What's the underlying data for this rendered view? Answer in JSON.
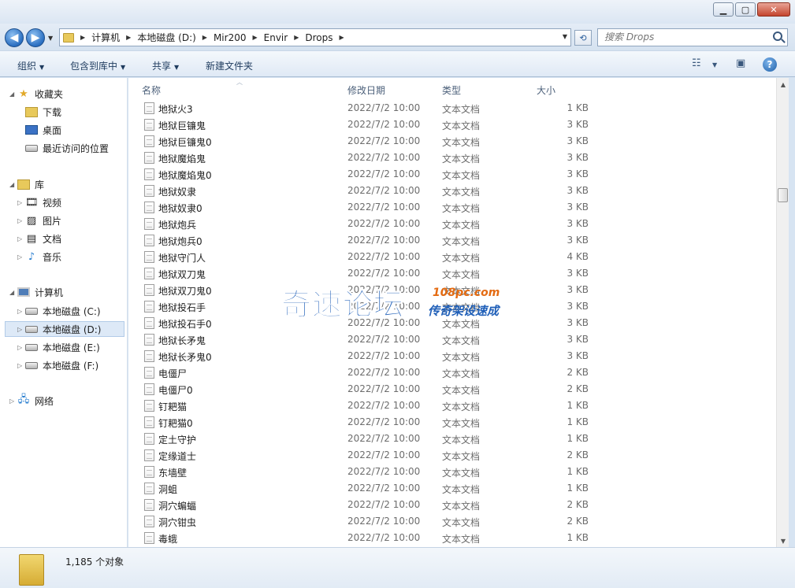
{
  "window": {
    "minimize_glyph": "▁",
    "maximize_glyph": "▢",
    "close_glyph": "✕"
  },
  "address": {
    "crumbs": [
      "计算机",
      "本地磁盘 (D:)",
      "Mir200",
      "Envir",
      "Drops"
    ],
    "search_placeholder": "搜索 Drops"
  },
  "toolbar": {
    "organize": "组织",
    "include_in_library": "包含到库中",
    "share": "共享",
    "new_folder": "新建文件夹"
  },
  "nav": {
    "favorites": "收藏夹",
    "downloads": "下载",
    "desktop": "桌面",
    "recent": "最近访问的位置",
    "libraries": "库",
    "videos": "视频",
    "pictures": "图片",
    "documents": "文档",
    "music": "音乐",
    "computer": "计算机",
    "drive_c": "本地磁盘 (C:)",
    "drive_d": "本地磁盘 (D:)",
    "drive_e": "本地磁盘 (E:)",
    "drive_f": "本地磁盘 (F:)",
    "network": "网络"
  },
  "columns": {
    "name": "名称",
    "date": "修改日期",
    "type": "类型",
    "size": "大小"
  },
  "files": [
    {
      "name": "地狱火3",
      "date": "2022/7/2 10:00",
      "type": "文本文档",
      "size": "1 KB"
    },
    {
      "name": "地狱巨镰鬼",
      "date": "2022/7/2 10:00",
      "type": "文本文档",
      "size": "3 KB"
    },
    {
      "name": "地狱巨镰鬼0",
      "date": "2022/7/2 10:00",
      "type": "文本文档",
      "size": "3 KB"
    },
    {
      "name": "地狱魔焰鬼",
      "date": "2022/7/2 10:00",
      "type": "文本文档",
      "size": "3 KB"
    },
    {
      "name": "地狱魔焰鬼0",
      "date": "2022/7/2 10:00",
      "type": "文本文档",
      "size": "3 KB"
    },
    {
      "name": "地狱奴隶",
      "date": "2022/7/2 10:00",
      "type": "文本文档",
      "size": "3 KB"
    },
    {
      "name": "地狱奴隶0",
      "date": "2022/7/2 10:00",
      "type": "文本文档",
      "size": "3 KB"
    },
    {
      "name": "地狱炮兵",
      "date": "2022/7/2 10:00",
      "type": "文本文档",
      "size": "3 KB"
    },
    {
      "name": "地狱炮兵0",
      "date": "2022/7/2 10:00",
      "type": "文本文档",
      "size": "3 KB"
    },
    {
      "name": "地狱守门人",
      "date": "2022/7/2 10:00",
      "type": "文本文档",
      "size": "4 KB"
    },
    {
      "name": "地狱双刀鬼",
      "date": "2022/7/2 10:00",
      "type": "文本文档",
      "size": "3 KB"
    },
    {
      "name": "地狱双刀鬼0",
      "date": "2022/7/2 10:00",
      "type": "文本文档",
      "size": "3 KB"
    },
    {
      "name": "地狱投石手",
      "date": "2022/7/2 10:00",
      "type": "文本文档",
      "size": "3 KB"
    },
    {
      "name": "地狱投石手0",
      "date": "2022/7/2 10:00",
      "type": "文本文档",
      "size": "3 KB"
    },
    {
      "name": "地狱长矛鬼",
      "date": "2022/7/2 10:00",
      "type": "文本文档",
      "size": "3 KB"
    },
    {
      "name": "地狱长矛鬼0",
      "date": "2022/7/2 10:00",
      "type": "文本文档",
      "size": "3 KB"
    },
    {
      "name": "电僵尸",
      "date": "2022/7/2 10:00",
      "type": "文本文档",
      "size": "2 KB"
    },
    {
      "name": "电僵尸0",
      "date": "2022/7/2 10:00",
      "type": "文本文档",
      "size": "2 KB"
    },
    {
      "name": "钉耙猫",
      "date": "2022/7/2 10:00",
      "type": "文本文档",
      "size": "1 KB"
    },
    {
      "name": "钉耙猫0",
      "date": "2022/7/2 10:00",
      "type": "文本文档",
      "size": "1 KB"
    },
    {
      "name": "定土守护",
      "date": "2022/7/2 10:00",
      "type": "文本文档",
      "size": "1 KB"
    },
    {
      "name": "定缘道士",
      "date": "2022/7/2 10:00",
      "type": "文本文档",
      "size": "2 KB"
    },
    {
      "name": "东墙壁",
      "date": "2022/7/2 10:00",
      "type": "文本文档",
      "size": "1 KB"
    },
    {
      "name": "洞蛆",
      "date": "2022/7/2 10:00",
      "type": "文本文档",
      "size": "1 KB"
    },
    {
      "name": "洞穴蝙蝠",
      "date": "2022/7/2 10:00",
      "type": "文本文档",
      "size": "2 KB"
    },
    {
      "name": "洞穴钳虫",
      "date": "2022/7/2 10:00",
      "type": "文本文档",
      "size": "2 KB"
    },
    {
      "name": "毒蛾",
      "date": "2022/7/2 10:00",
      "type": "文本文档",
      "size": "1 KB"
    }
  ],
  "watermark": {
    "main": "奇速论坛",
    "url": "108pc.com",
    "sub": "传奇架设速成"
  },
  "status": {
    "count": "1,185 个对象"
  },
  "icons": {
    "file": "text-file-icon",
    "folder": "folder-icon",
    "back": "back-arrow-icon",
    "forward": "forward-arrow-icon"
  }
}
